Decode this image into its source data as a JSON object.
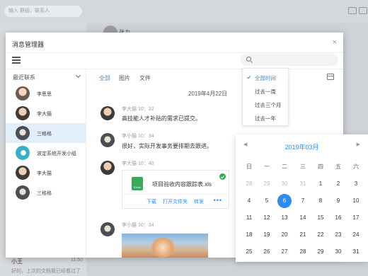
{
  "background": {
    "search_placeholder": "输入 群组、联系人",
    "top_name": "张力",
    "bottom_name": "小王",
    "bottom_time": "11:50",
    "bottom_message": "好的，上次的文档我已经看过了"
  },
  "modal": {
    "title": "消息管理器",
    "close": "×"
  },
  "contacts": {
    "header": "最近联系",
    "items": [
      {
        "name": "李思思"
      },
      {
        "name": "李大猫"
      },
      {
        "name": "三格格"
      },
      {
        "name": "波定系统开发小组"
      },
      {
        "name": "李大猫"
      },
      {
        "name": "三格格"
      }
    ]
  },
  "tabs": [
    "全部",
    "图片",
    "文件"
  ],
  "date_header": "2019年4月22日",
  "messages": [
    {
      "meta": "李大猫  10：32",
      "text": "高技能人才补贴的需求已提交。"
    },
    {
      "meta": "李小猫  10：34",
      "text": "很好，实际开发事务要排期去跟进。"
    },
    {
      "meta": "李大猫  10：40"
    },
    {
      "meta": "李小猫  10：34"
    }
  ],
  "file": {
    "icon_label": "Excel",
    "name": "项目验收内容跟踪表.xls",
    "actions": [
      "下载",
      "打开文件夹",
      "转发"
    ],
    "more": "•••"
  },
  "time_filter": {
    "options": [
      "全部时间",
      "过去一周",
      "过去三个月",
      "过去一年"
    ],
    "selected": 0
  },
  "calendar": {
    "month": "2019年03月",
    "prev": "◀",
    "next": "▶",
    "weekdays": [
      "日",
      "一",
      "二",
      "三",
      "四",
      "五",
      "六"
    ],
    "days": [
      [
        "28",
        "29",
        "30",
        "31",
        "1",
        "2",
        "3"
      ],
      [
        "4",
        "5",
        "6",
        "7",
        "8",
        "9",
        "10"
      ],
      [
        "11",
        "12",
        "13",
        "14",
        "15",
        "16",
        "17"
      ],
      [
        "18",
        "19",
        "20",
        "21",
        "22",
        "23",
        "24"
      ],
      [
        "25",
        "26",
        "27",
        "28",
        "29",
        "30",
        "31"
      ]
    ],
    "selected_day": "6"
  },
  "colors": {
    "accent": "#2d8cf0",
    "selected_row": "#e3eefb",
    "excel": "#3aaa5a"
  }
}
